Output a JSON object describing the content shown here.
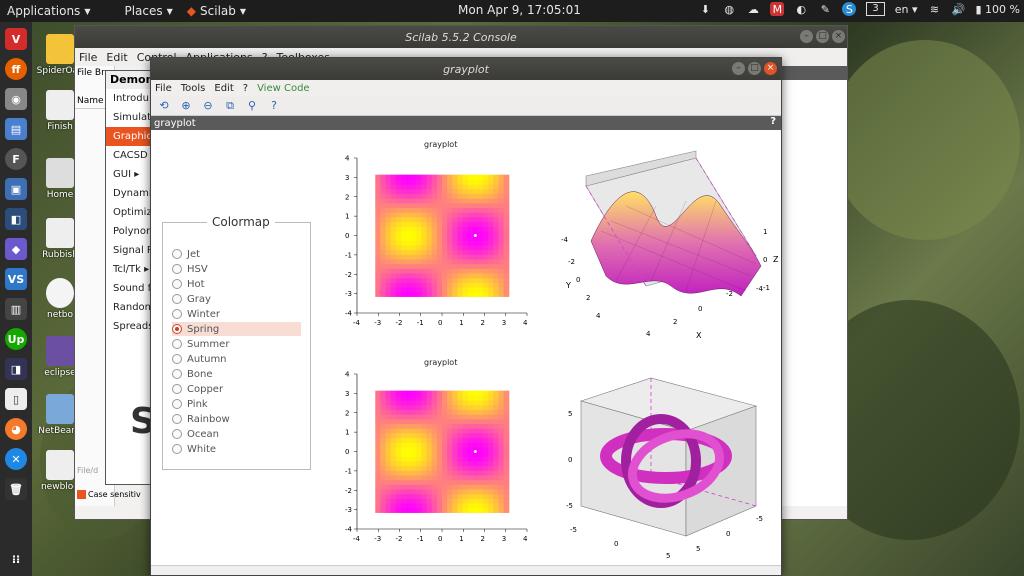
{
  "topbar": {
    "applications": "Applications",
    "places": "Places",
    "app": "Scilab",
    "clock": "Mon Apr  9, 17:05:01",
    "workspace": "3",
    "lang": "en",
    "battery": "100 %"
  },
  "desktop_icons": [
    {
      "label": "SpiderOak"
    },
    {
      "label": "Finish"
    },
    {
      "label": "Home"
    },
    {
      "label": "Rubbish"
    },
    {
      "label": "netbo"
    },
    {
      "label": "eclipse"
    },
    {
      "label": "NetBeans"
    },
    {
      "label": "newblog"
    }
  ],
  "console_window": {
    "title": "Scilab 5.5.2 Console",
    "menu": [
      "File",
      "Edit",
      "Control",
      "Applications",
      "?",
      "Toolboxes"
    ]
  },
  "filebrowser": {
    "menu": "File Br",
    "name_header": "Name",
    "path_placeholder": "File/d",
    "case_sensitive": "Case sensitiv"
  },
  "demos_window": {
    "title": "Demons",
    "items": [
      "Introdu",
      "Simulati",
      "Graphic",
      "CACSD ▸",
      "GUI ▸",
      "Dynamic",
      "Optimiz",
      "Polynom",
      "Signal P",
      "Tcl/Tk ▸",
      "Sound f",
      "Random",
      "Spreads"
    ],
    "selected_index": 2
  },
  "grayplot_window": {
    "title": "grayplot",
    "menu": [
      "File",
      "Tools",
      "Edit",
      "?",
      "View Code"
    ],
    "dock_title": "grayplot",
    "dock_help": "?"
  },
  "colormap": {
    "title": "Colormap",
    "options": [
      "Jet",
      "HSV",
      "Hot",
      "Gray",
      "Winter",
      "Spring",
      "Summer",
      "Autumn",
      "Bone",
      "Copper",
      "Pink",
      "Rainbow",
      "Ocean",
      "White"
    ],
    "selected": "Spring"
  },
  "plots": {
    "title1": "grayplot",
    "title2": "grayplot",
    "ticks_x": [
      "-4",
      "-3",
      "-2",
      "-1",
      "0",
      "1",
      "2",
      "3",
      "4"
    ],
    "ticks_y": [
      "4",
      "3",
      "2",
      "1",
      "0",
      "-1",
      "-2",
      "-3",
      "-4"
    ],
    "surface_labels": {
      "x": "X",
      "y": "Y",
      "z": "Z"
    },
    "surface_ticks": {
      "z": [
        "1",
        "0",
        "-1"
      ],
      "x": [
        "2",
        "0",
        "-2",
        "-4"
      ],
      "y": [
        "-4",
        "-2",
        "0",
        "2",
        "4"
      ],
      "x2": [
        "4"
      ]
    },
    "torus_ticks": {
      "z": [
        "5",
        "0",
        "-5"
      ],
      "x": [
        "-5",
        "0",
        "5"
      ],
      "y": [
        "-5",
        "0",
        "5"
      ]
    }
  },
  "colors": {
    "spring_magenta": "#ff00ff",
    "spring_yellow": "#ffff00",
    "accent_orange": "#e95420",
    "titlebar": "#3c3b37"
  }
}
